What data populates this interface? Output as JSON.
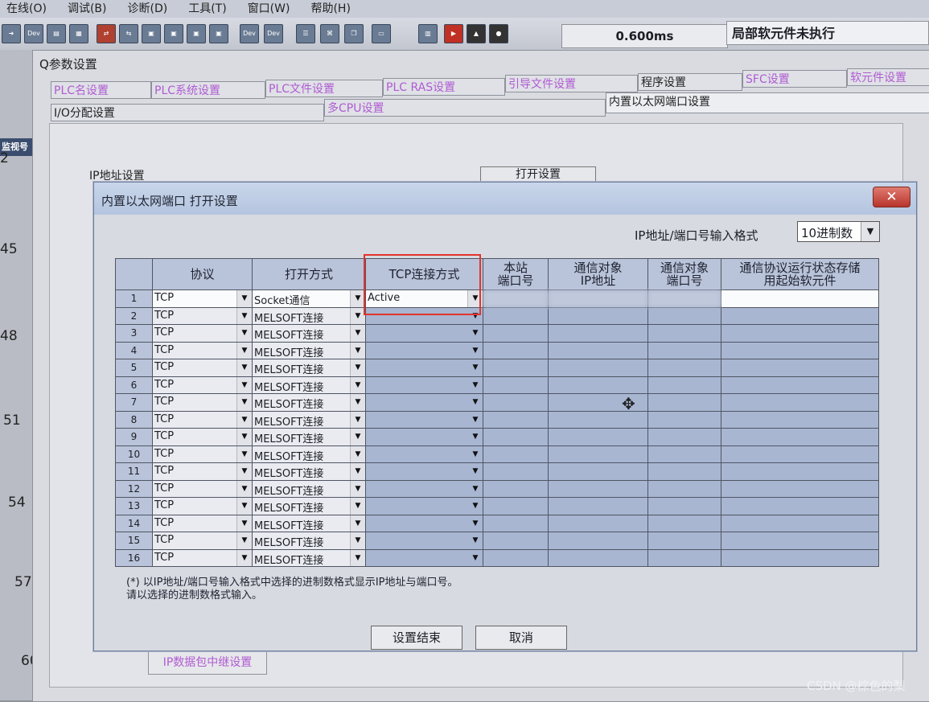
{
  "menubar": {
    "items": [
      "在线(O)",
      "调试(B)",
      "诊断(D)",
      "工具(T)",
      "窗口(W)",
      "帮助(H)"
    ]
  },
  "toolbar": {
    "scan_time": "0.600ms",
    "exec_status": "局部软元件未执行"
  },
  "left_panel": {
    "monitor_tab": "监视号",
    "row_numbers": [
      "2",
      "45",
      "48",
      "51",
      "54",
      "57",
      "60"
    ]
  },
  "q_window": {
    "title": "Q参数设置",
    "tabs_row1": [
      "PLC名设置",
      "PLC系统设置",
      "PLC文件设置",
      "PLC RAS设置",
      "引导文件设置",
      "程序设置",
      "SFC设置",
      "软元件设置"
    ],
    "tabs_row2": [
      "I/O分配设置",
      "多CPU设置",
      "内置以太网端口设置"
    ],
    "ip_group_label": "IP地址设置",
    "open_settings_button": "打开设置",
    "relay_button": "IP数据包中继设置"
  },
  "dialog": {
    "title": "内置以太网端口 打开设置",
    "close_label": "✕",
    "format_label": "IP地址/端口号输入格式",
    "format_value": "10进制数",
    "columns": [
      "协议",
      "打开方式",
      "TCP连接方式",
      "本站\n端口号",
      "通信对象\nIP地址",
      "通信对象\n端口号",
      "通信协议运行状态存储\n用起始软元件"
    ],
    "rows": [
      {
        "no": "1",
        "protocol": "TCP",
        "open_method": "Socket通信",
        "tcp_mode": "Active"
      },
      {
        "no": "2",
        "protocol": "TCP",
        "open_method": "MELSOFT连接",
        "tcp_mode": ""
      },
      {
        "no": "3",
        "protocol": "TCP",
        "open_method": "MELSOFT连接",
        "tcp_mode": ""
      },
      {
        "no": "4",
        "protocol": "TCP",
        "open_method": "MELSOFT连接",
        "tcp_mode": ""
      },
      {
        "no": "5",
        "protocol": "TCP",
        "open_method": "MELSOFT连接",
        "tcp_mode": ""
      },
      {
        "no": "6",
        "protocol": "TCP",
        "open_method": "MELSOFT连接",
        "tcp_mode": ""
      },
      {
        "no": "7",
        "protocol": "TCP",
        "open_method": "MELSOFT连接",
        "tcp_mode": ""
      },
      {
        "no": "8",
        "protocol": "TCP",
        "open_method": "MELSOFT连接",
        "tcp_mode": ""
      },
      {
        "no": "9",
        "protocol": "TCP",
        "open_method": "MELSOFT连接",
        "tcp_mode": ""
      },
      {
        "no": "10",
        "protocol": "TCP",
        "open_method": "MELSOFT连接",
        "tcp_mode": ""
      },
      {
        "no": "11",
        "protocol": "TCP",
        "open_method": "MELSOFT连接",
        "tcp_mode": ""
      },
      {
        "no": "12",
        "protocol": "TCP",
        "open_method": "MELSOFT连接",
        "tcp_mode": ""
      },
      {
        "no": "13",
        "protocol": "TCP",
        "open_method": "MELSOFT连接",
        "tcp_mode": ""
      },
      {
        "no": "14",
        "protocol": "TCP",
        "open_method": "MELSOFT连接",
        "tcp_mode": ""
      },
      {
        "no": "15",
        "protocol": "TCP",
        "open_method": "MELSOFT连接",
        "tcp_mode": ""
      },
      {
        "no": "16",
        "protocol": "TCP",
        "open_method": "MELSOFT连接",
        "tcp_mode": ""
      }
    ],
    "footnote": [
      "(*) 以IP地址/端口号输入格式中选择的进制数格式显示IP地址与端口号。",
      "请以选择的进制数格式输入。"
    ],
    "ok_button": "设置结束",
    "cancel_button": "取消",
    "highlight_color": "#e3332b"
  },
  "watermark": "CSDN @棕色的梨"
}
